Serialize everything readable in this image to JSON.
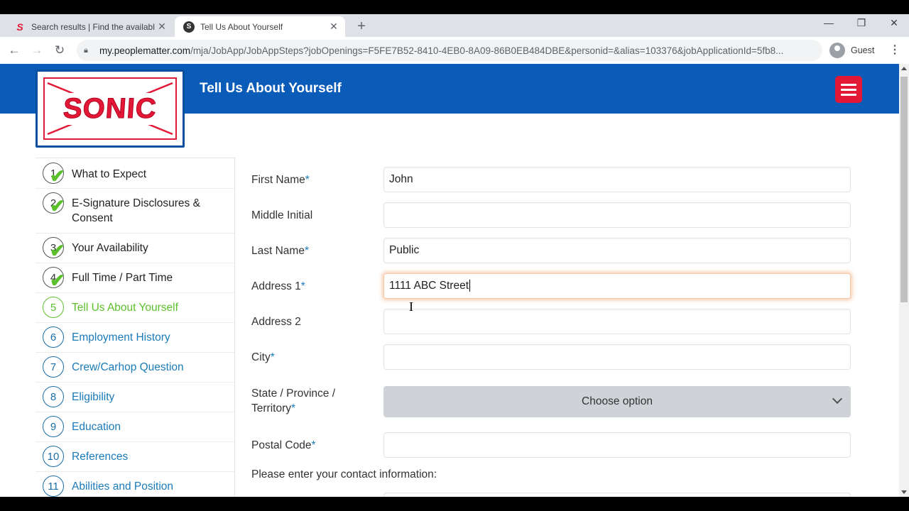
{
  "browser": {
    "tabs": [
      {
        "title": "Search results | Find the available",
        "favicon": "sonic-s-icon",
        "active": false
      },
      {
        "title": "Tell Us About Yourself",
        "favicon": "s-circle-icon",
        "active": true
      }
    ],
    "url_host": "my.peoplematter.com",
    "url_path": "/mja/JobApp/JobAppSteps?jobOpenings=F5FE7B52-8410-4EB0-8A09-86B0EB484DBE&personid=&alias=103376&jobApplicationId=5fb8...",
    "profile_label": "Guest"
  },
  "header": {
    "logo_text": "SONIC",
    "title": "Tell Us About Yourself",
    "colors": {
      "banner": "#0b5cb8",
      "menu_button": "#e31837",
      "done_check": "#5cc02d",
      "link": "#1a7bb8"
    }
  },
  "steps": [
    {
      "num": "1",
      "label": "What to Expect",
      "state": "done"
    },
    {
      "num": "2",
      "label": "E-Signature Disclosures & Consent",
      "state": "done"
    },
    {
      "num": "3",
      "label": "Your Availability",
      "state": "done"
    },
    {
      "num": "4",
      "label": "Full Time / Part Time",
      "state": "done"
    },
    {
      "num": "5",
      "label": "Tell Us About Yourself",
      "state": "current"
    },
    {
      "num": "6",
      "label": "Employment History",
      "state": "future"
    },
    {
      "num": "7",
      "label": "Crew/Carhop Question",
      "state": "future"
    },
    {
      "num": "8",
      "label": "Eligibility",
      "state": "future"
    },
    {
      "num": "9",
      "label": "Education",
      "state": "future"
    },
    {
      "num": "10",
      "label": "References",
      "state": "future"
    },
    {
      "num": "11",
      "label": "Abilities and Position",
      "state": "future"
    }
  ],
  "form": {
    "first_name": {
      "label": "First Name",
      "required": "*",
      "value": "John"
    },
    "middle_initial": {
      "label": "Middle Initial",
      "value": ""
    },
    "last_name": {
      "label": "Last Name",
      "required": "*",
      "value": "Public"
    },
    "address1": {
      "label": "Address 1",
      "required": "*",
      "value": "1111 ABC Street"
    },
    "address2": {
      "label": "Address 2",
      "value": ""
    },
    "city": {
      "label": "City",
      "required": "*",
      "value": ""
    },
    "state": {
      "label": "State / Province / Territory",
      "required": "*",
      "selected": "Choose option"
    },
    "postal_code": {
      "label": "Postal Code",
      "required": "*",
      "value": ""
    },
    "contact_prompt": "Please enter your contact information:"
  }
}
